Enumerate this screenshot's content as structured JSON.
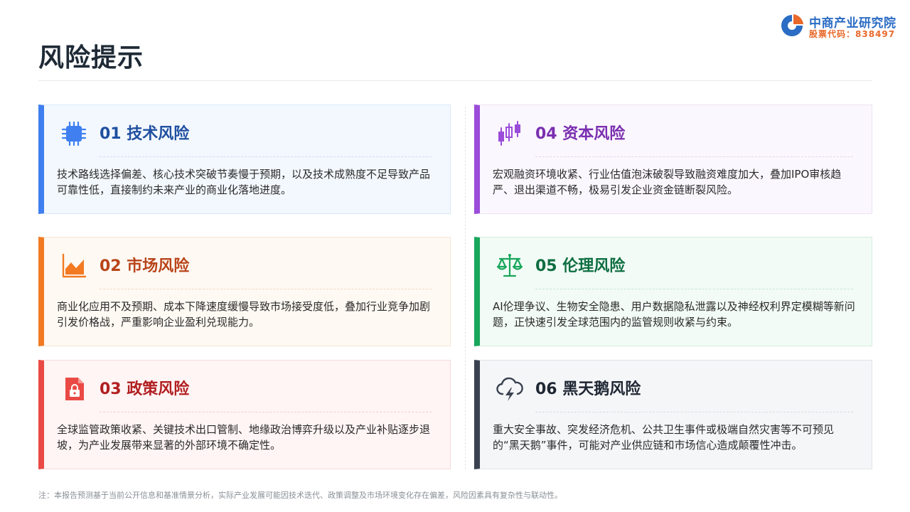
{
  "page_title": "风险提示",
  "logo": {
    "name": "中商产业研究院",
    "code": "股票代码：838497"
  },
  "colors": {
    "tech": "#3f7ff0",
    "market": "#f27a22",
    "policy": "#ea4a45",
    "capital": "#9b4cd9",
    "ethics": "#18a75b",
    "black_swan": "#3a4250"
  },
  "risks": [
    {
      "title": "01 技术风险",
      "icon": "chip-icon",
      "body": "技术路线选择偏差、核心技术突破节奏慢于预期，以及技术成熟度不足导致产品可靠性低，直接制约未来产业的商业化落地进度。"
    },
    {
      "title": "02 市场风险",
      "icon": "area-chart-icon",
      "body": "商业化应用不及预期、成本下降速度缓慢导致市场接受度低，叠加行业竞争加剧引发价格战，严重影响企业盈利兑现能力。"
    },
    {
      "title": "03 政策风险",
      "icon": "document-lock-icon",
      "body": "全球监管政策收紧、关键技术出口管制、地缘政治博弈升级以及产业补贴逐步退坡，为产业发展带来显著的外部环境不确定性。"
    },
    {
      "title": "04 资本风险",
      "icon": "candlestick-icon",
      "body": "宏观融资环境收紧、行业估值泡沫破裂导致融资难度加大，叠加IPO审核趋严、退出渠道不畅，极易引发企业资金链断裂风险。"
    },
    {
      "title": "05 伦理风险",
      "icon": "balance-scale-icon",
      "body": "AI伦理争议、生物安全隐患、用户数据隐私泄露以及神经权利界定模糊等新问题，正快速引发全球范围内的监管规则收紧与约束。"
    },
    {
      "title": "06 黑天鹅风险",
      "icon": "storm-cloud-icon",
      "body": "重大安全事故、突发经济危机、公共卫生事件或极端自然灾害等不可预见的“黑天鹅”事件，可能对产业供应链和市场信心造成颠覆性冲击。"
    }
  ],
  "footnote": "注：本报告预测基于当前公开信息和基准情景分析，实际产业发展可能因技术迭代、政策调整及市场环境变化存在偏差，风险因素具有复杂性与联动性。"
}
